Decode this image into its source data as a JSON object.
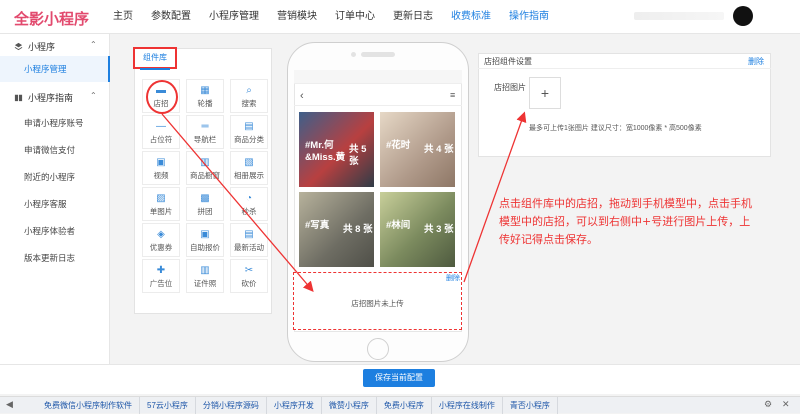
{
  "logo": "全影小程序",
  "nav": [
    "主页",
    "参数配置",
    "小程序管理",
    "营销模块",
    "订单中心",
    "更新日志",
    "收费标准",
    "操作指南"
  ],
  "sidebar": {
    "group1": "小程序",
    "group1_items": [
      "小程序管理"
    ],
    "group2": "小程序指南",
    "group2_items": [
      "申请小程序账号",
      "申请微信支付",
      "附近的小程序",
      "小程序客服",
      "小程序体验者",
      "版本更新日志"
    ]
  },
  "component_lib": {
    "tab": "组件库",
    "items": [
      {
        "label": "店招",
        "icon": "store-icon"
      },
      {
        "label": "轮播",
        "icon": "carousel-icon"
      },
      {
        "label": "搜索",
        "icon": "search-icon"
      },
      {
        "label": "占位符",
        "icon": "placeholder-icon"
      },
      {
        "label": "导航栏",
        "icon": "navbar-icon"
      },
      {
        "label": "商品分类",
        "icon": "category-icon"
      },
      {
        "label": "视频",
        "icon": "video-icon"
      },
      {
        "label": "商品橱窗",
        "icon": "showcase-icon"
      },
      {
        "label": "相册展示",
        "icon": "album-icon"
      },
      {
        "label": "单图片",
        "icon": "image-icon"
      },
      {
        "label": "拼团",
        "icon": "group-buy-icon"
      },
      {
        "label": "秒杀",
        "icon": "flash-sale-icon"
      },
      {
        "label": "优惠券",
        "icon": "coupon-icon"
      },
      {
        "label": "自助报价",
        "icon": "quote-icon"
      },
      {
        "label": "最新活动",
        "icon": "activity-icon"
      },
      {
        "label": "广告位",
        "icon": "ad-icon"
      },
      {
        "label": "证件照",
        "icon": "id-photo-icon"
      },
      {
        "label": "砍价",
        "icon": "bargain-icon"
      }
    ]
  },
  "phone": {
    "photos": [
      {
        "title": "#Mr.何\n&Miss.黄",
        "count": "共 5\n张",
        "color": "#5a6f86"
      },
      {
        "title": "#花时",
        "count": "共 4 张",
        "color": "#c9b7a6"
      },
      {
        "title": "#写真",
        "count": "共 8 张",
        "color": "#8a8a82"
      },
      {
        "title": "#林间",
        "count": "共 3 张",
        "color": "#7c8a68"
      }
    ],
    "drop_text": "店招图片未上传",
    "drop_delete": "删除"
  },
  "settings": {
    "title": "店招组件设置",
    "delete": "删除",
    "image_label": "店招图片",
    "upload": "+",
    "tip": "最多可上传1张图片 建议尺寸：宽1000像素 * 高500像素"
  },
  "annotation": "点击组件库中的店招，拖动到手机模型中，点击手机模型中的店招，可以到右侧中+号进行图片上传，上传好记得点击保存。",
  "save_button": "保存当前配置",
  "taskbar": [
    "免费微信小程序制作软件",
    "57云小程序",
    "分销小程序源码",
    "小程序开发",
    "微赞小程序",
    "免费小程序",
    "小程序在线制作",
    "青否小程序"
  ]
}
